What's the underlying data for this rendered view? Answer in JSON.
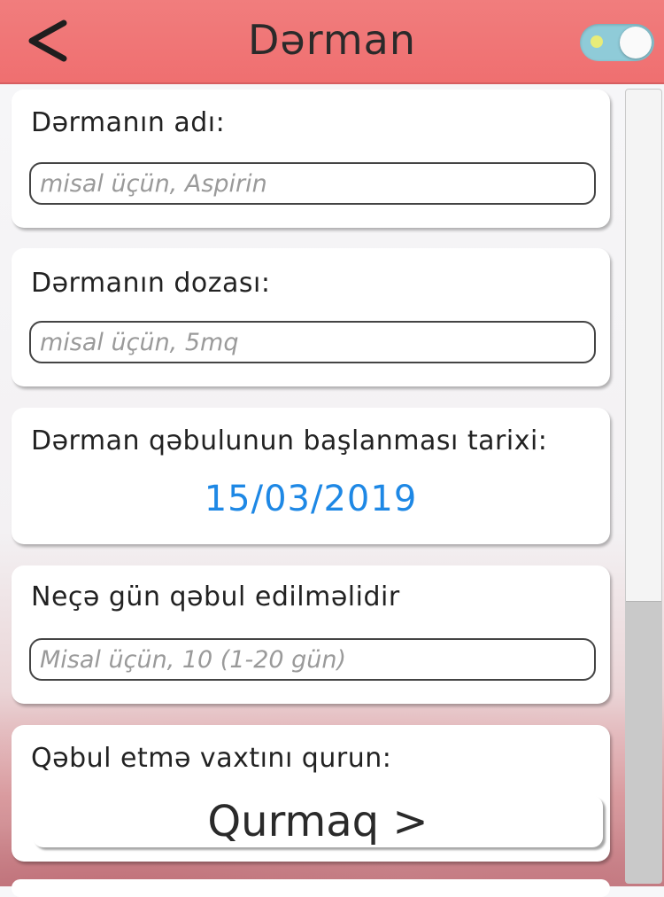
{
  "header": {
    "title": "Dərman",
    "back_icon": "chevron-left-icon",
    "toggle": {
      "state": "on",
      "colors": {
        "track": "#8fcbd8",
        "dot": "#e8ec78",
        "knob": "#fafafa"
      }
    }
  },
  "colors": {
    "header_bg": "#ef6f70",
    "date_accent": "#1e88e5",
    "card_bg": "#ffffff"
  },
  "form": {
    "name": {
      "label": "Dərmanın adı:",
      "value": "",
      "placeholder": "misal üçün, Aspirin"
    },
    "dose": {
      "label": "Dərmanın dozası:",
      "value": "",
      "placeholder": "misal üçün, 5mq"
    },
    "start_date": {
      "label": "Dərman qəbulunun başlanması tarixi:",
      "value": "15/03/2019"
    },
    "days": {
      "label": "Neçə gün qəbul edilməlidir",
      "value": "",
      "placeholder": "Misal üçün, 10 (1-20 gün)"
    },
    "schedule": {
      "label": "Qəbul etmə vaxtını qurun:",
      "button_label": "Qurmaq >"
    }
  }
}
